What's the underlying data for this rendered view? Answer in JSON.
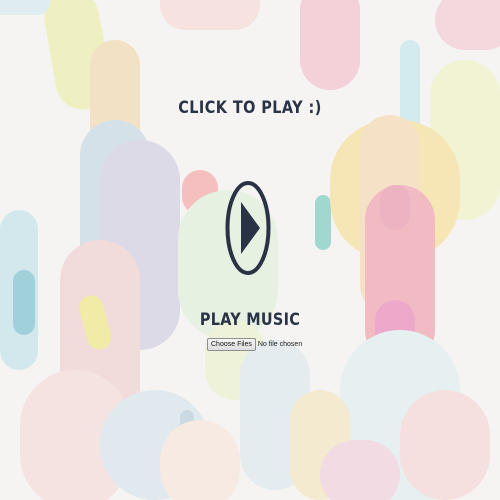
{
  "page": {
    "title": "CLICK TO PLAY :)",
    "play_music_label": "PLAY MUSIC"
  },
  "player": {
    "play_icon": "play-circle-icon"
  },
  "file_input": {
    "button_label": "Choose Files",
    "status_text": "No file chosen"
  },
  "colors": {
    "text": "#2a3346",
    "background": "#f5f4f2"
  }
}
